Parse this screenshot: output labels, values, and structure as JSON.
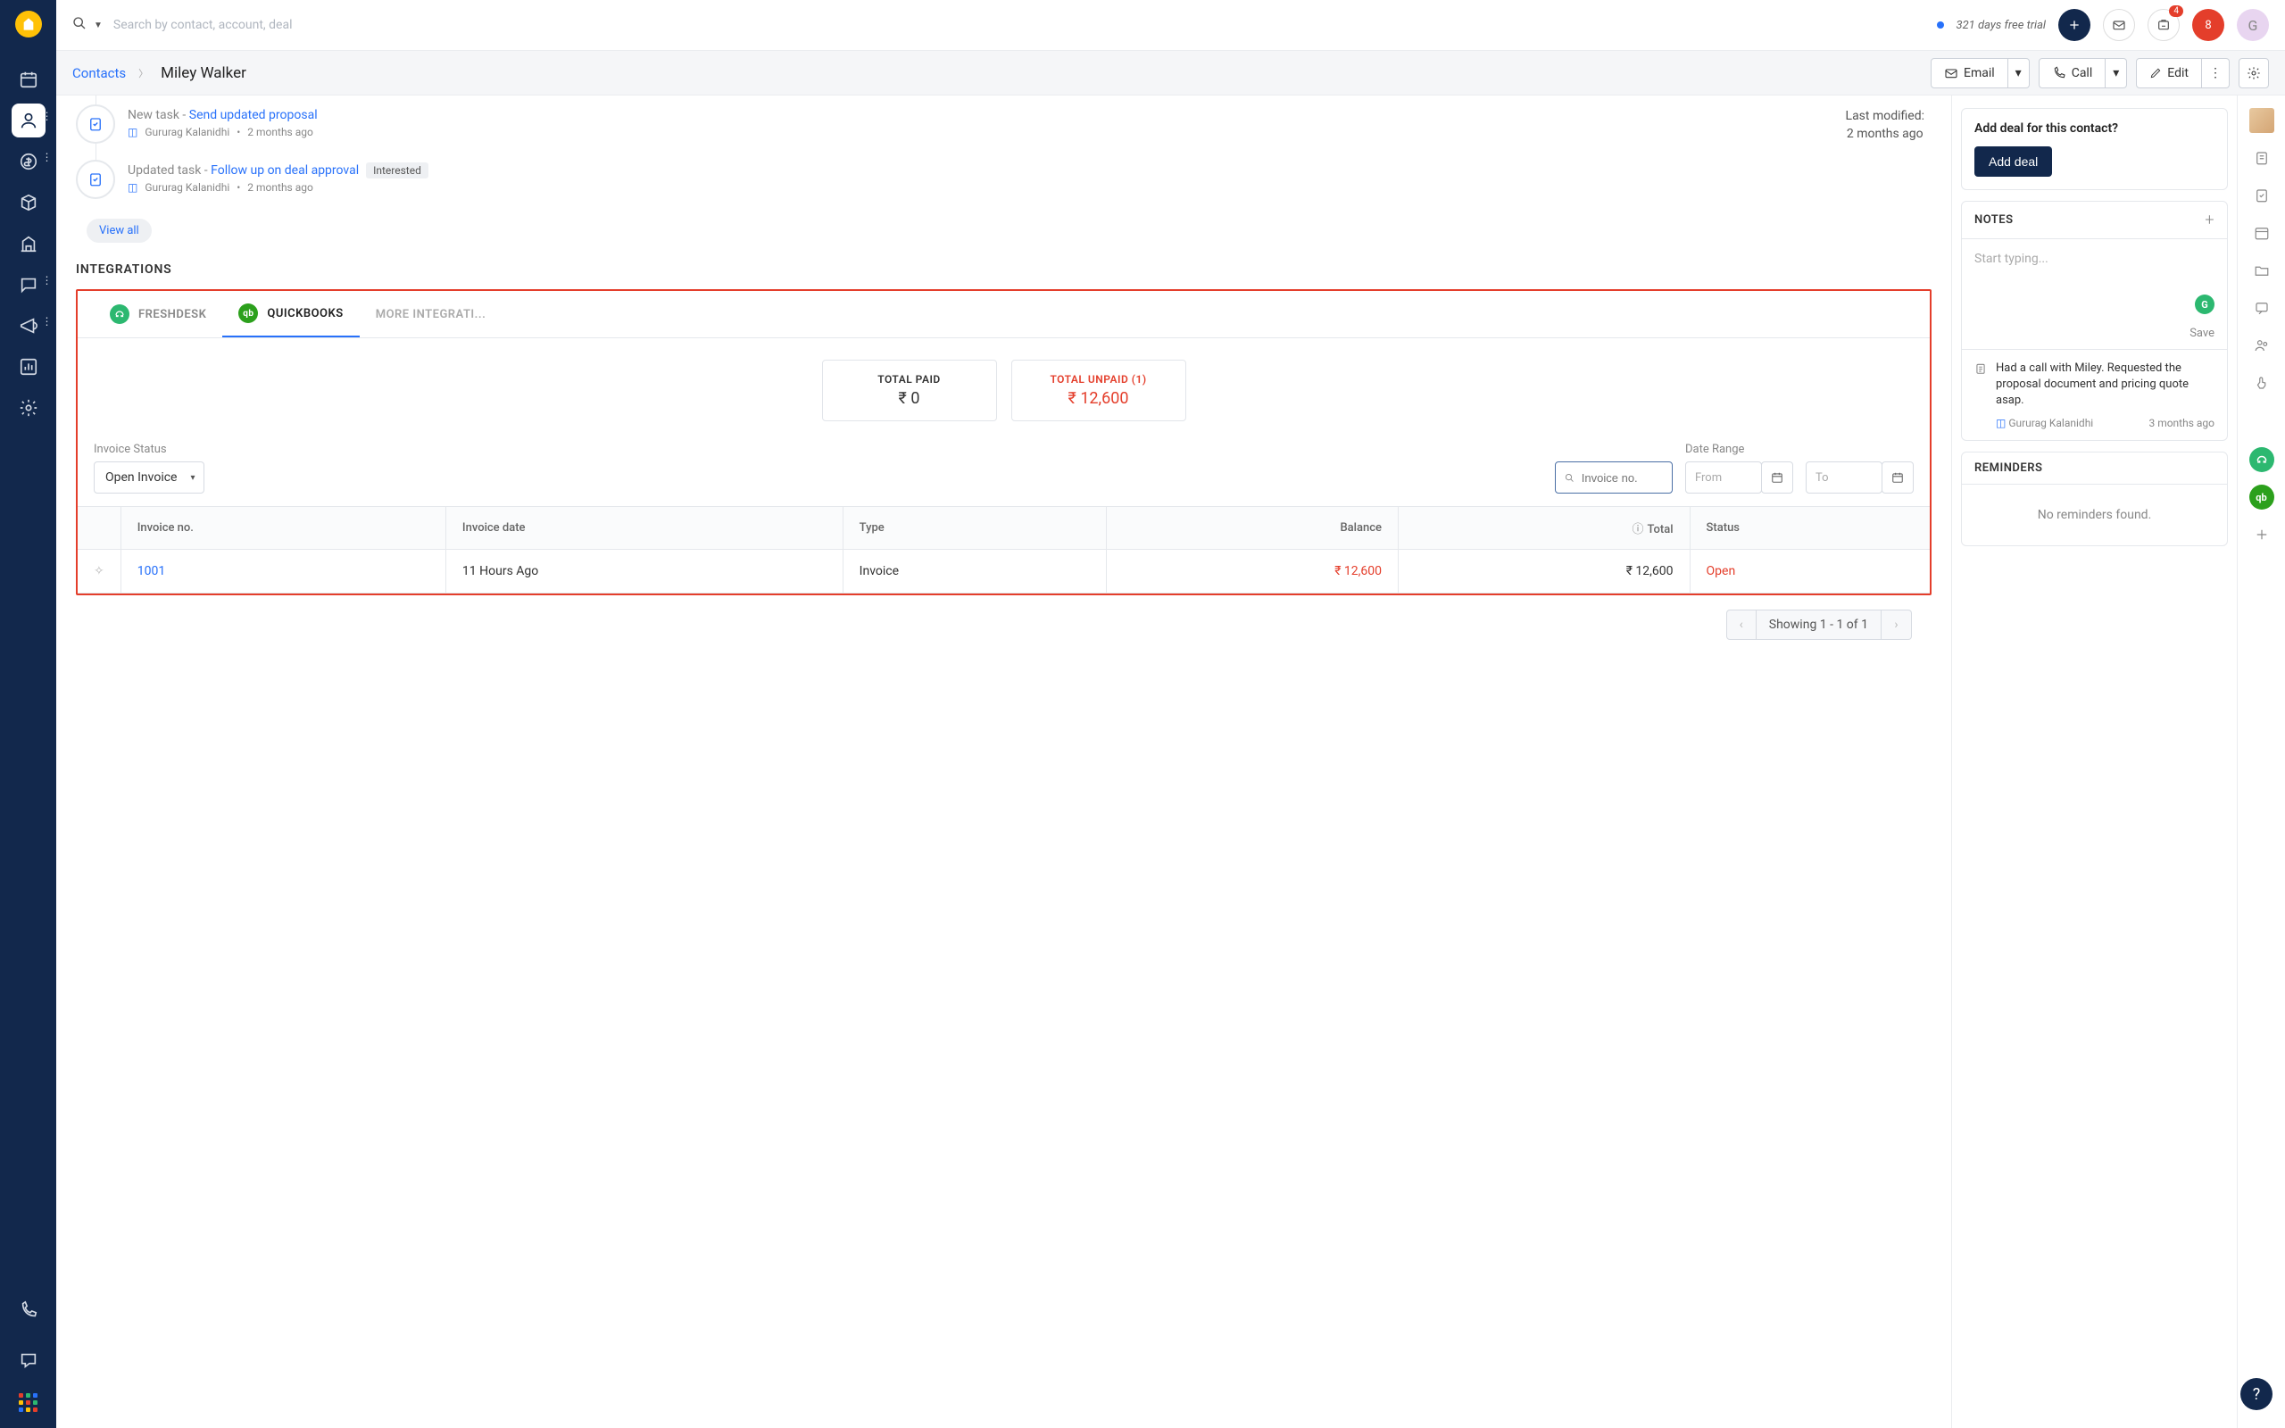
{
  "topbar": {
    "search_placeholder": "Search by contact, account, deal",
    "trial": "321 days free trial",
    "badge_count": "4",
    "red_count": "8",
    "avatar_initial": "G"
  },
  "breadcrumb": {
    "parent": "Contacts",
    "title": "Miley Walker"
  },
  "actions": {
    "email": "Email",
    "call": "Call",
    "edit": "Edit"
  },
  "last_modified": {
    "label": "Last modified:",
    "value": "2 months ago"
  },
  "timeline": [
    {
      "prefix": "New task - ",
      "link_text": "Send updated proposal",
      "tag": "",
      "user": "Gururag Kalanidhi",
      "time": "2 months ago"
    },
    {
      "prefix": "Updated task - ",
      "link_text": "Follow up on deal approval",
      "tag": "Interested",
      "user": "Gururag Kalanidhi",
      "time": "2 months ago"
    }
  ],
  "view_all": "View all",
  "integrations": {
    "heading": "INTEGRATIONS",
    "tabs": {
      "freshdesk": "FRESHDESK",
      "quickbooks": "QUICKBOOKS",
      "more": "MORE INTEGRATI..."
    },
    "summary": {
      "paid_label": "TOTAL PAID",
      "paid_value": "₹ 0",
      "unpaid_label": "TOTAL UNPAID (1)",
      "unpaid_value": "₹ 12,600"
    },
    "filters": {
      "status_label": "Invoice Status",
      "status_value": "Open Invoice",
      "search_placeholder": "Invoice no.",
      "date_label": "Date Range",
      "from_ph": "From",
      "to_ph": "To"
    },
    "columns": {
      "invoice_no": "Invoice no.",
      "invoice_date": "Invoice date",
      "type": "Type",
      "balance": "Balance",
      "total": "Total",
      "status": "Status"
    },
    "rows": [
      {
        "no": "1001",
        "date": "11 Hours Ago",
        "type": "Invoice",
        "balance": "₹ 12,600",
        "total": "₹ 12,600",
        "status": "Open"
      }
    ],
    "pagination": "Showing 1 - 1 of 1"
  },
  "sidebar": {
    "deal_prompt": "Add deal for this contact?",
    "add_deal": "Add deal",
    "notes_heading": "NOTES",
    "note_placeholder": "Start typing...",
    "save": "Save",
    "note_text": "Had a call with Miley. Requested the proposal document and pricing quote asap.",
    "note_user": "Gururag Kalanidhi",
    "note_time": "3 months ago",
    "reminders_heading": "REMINDERS",
    "reminders_empty": "No reminders found."
  }
}
